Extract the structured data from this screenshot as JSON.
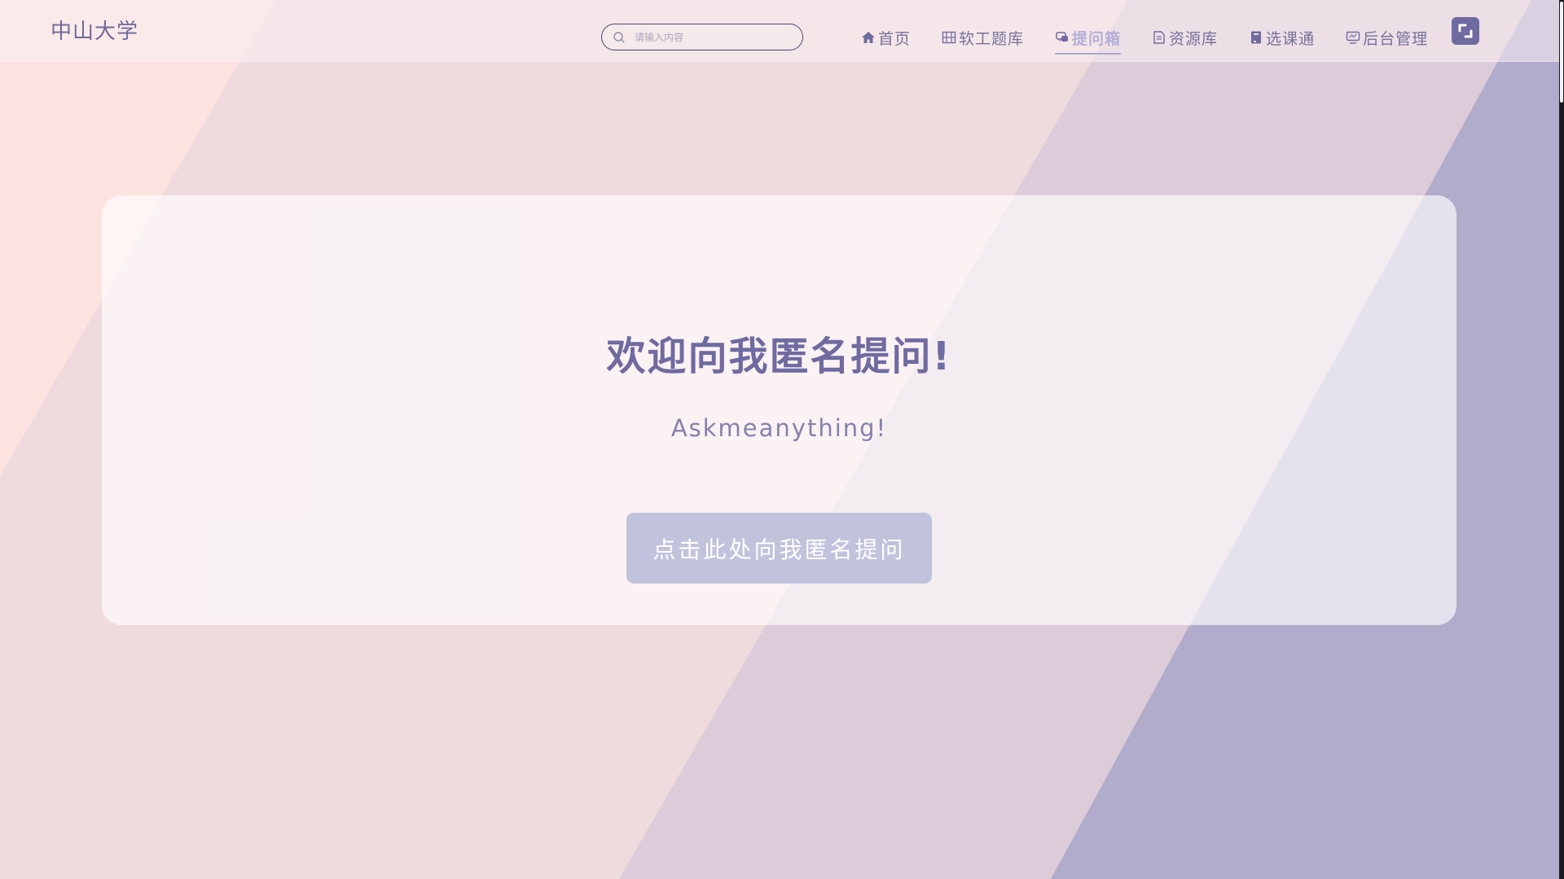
{
  "header": {
    "brand": "中山大学",
    "search": {
      "placeholder": "请输入内容",
      "value": ""
    },
    "nav": [
      {
        "label": "首页",
        "icon": "home-icon",
        "active": false
      },
      {
        "label": "软工题库",
        "icon": "grid-icon",
        "active": false
      },
      {
        "label": "提问箱",
        "icon": "chat-icon",
        "active": true
      },
      {
        "label": "资源库",
        "icon": "document-icon",
        "active": false
      },
      {
        "label": "选课通",
        "icon": "book-icon",
        "active": false
      },
      {
        "label": "后台管理",
        "icon": "monitor-icon",
        "active": false
      }
    ],
    "fullscreen_icon": "fullscreen-icon"
  },
  "main": {
    "title": "欢迎向我匿名提问!",
    "subtitle": "Askmeanything!",
    "button_label": "点击此处向我匿名提问"
  },
  "colors": {
    "accent": "#6f6aa0",
    "button": "#c1c3dd",
    "nav_active": "#b3b0d8",
    "band_pink": "#fde0dc",
    "band_purple": "#b1abcc"
  }
}
